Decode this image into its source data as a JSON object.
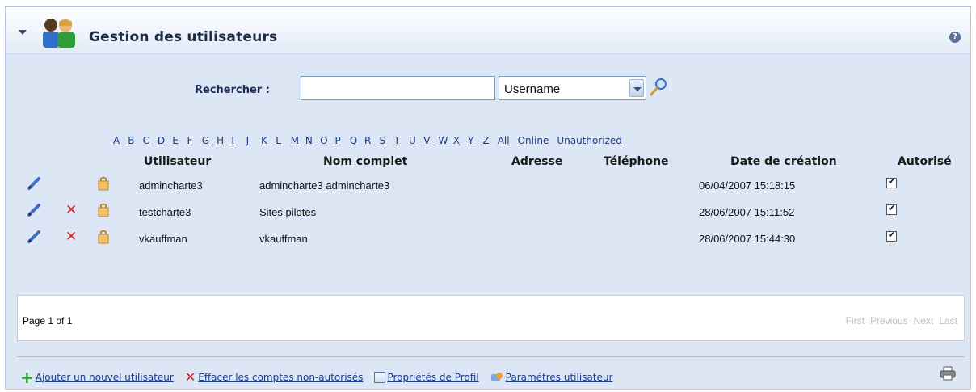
{
  "panel": {
    "title": "Gestion des utilisateurs",
    "icon": "users-group-icon",
    "help_icon": "help-icon",
    "help_glyph": "?"
  },
  "search": {
    "label": "Rechercher :",
    "value": "",
    "field": "Username"
  },
  "alphabet": [
    "A",
    "B",
    "C",
    "D",
    "E",
    "F",
    "G",
    "H",
    "I",
    "J",
    "K",
    "L",
    "M",
    "N",
    "O",
    "P",
    "Q",
    "R",
    "S",
    "T",
    "U",
    "V",
    "W",
    "X",
    "Y",
    "Z"
  ],
  "filters": [
    "All",
    "Online",
    "Unauthorized"
  ],
  "columns": {
    "username": "Utilisateur",
    "fullname": "Nom complet",
    "address": "Adresse",
    "phone": "Téléphone",
    "created": "Date de création",
    "authorized": "Autorisé"
  },
  "users": [
    {
      "username": "admincharte3",
      "fullname": "admincharte3 admincharte3",
      "address": "",
      "phone": "",
      "created": "06/04/2007 15:18:15",
      "authorized": true,
      "deletable": false
    },
    {
      "username": "testcharte3",
      "fullname": "Sites pilotes",
      "address": "",
      "phone": "",
      "created": "28/06/2007 15:11:52",
      "authorized": true,
      "deletable": true
    },
    {
      "username": "vkauffman",
      "fullname": "vkauffman",
      "address": "",
      "phone": "",
      "created": "28/06/2007 15:44:30",
      "authorized": true,
      "deletable": true
    }
  ],
  "pager": {
    "info": "Page 1 of 1",
    "first": "First",
    "previous": "Previous",
    "next": "Next",
    "last": "Last"
  },
  "actions": {
    "add_user": "Ajouter un nouvel utilisateur",
    "delete_unauthorized": "Effacer les comptes non-autorisés",
    "profile_properties": "Propriétés de Profil",
    "user_settings": "Paramétres utilisateur"
  },
  "colors": {
    "panel_bg": "#dde6f4",
    "link": "#1a3c8c",
    "delete_red": "#d21f1f",
    "add_green": "#29a329"
  }
}
